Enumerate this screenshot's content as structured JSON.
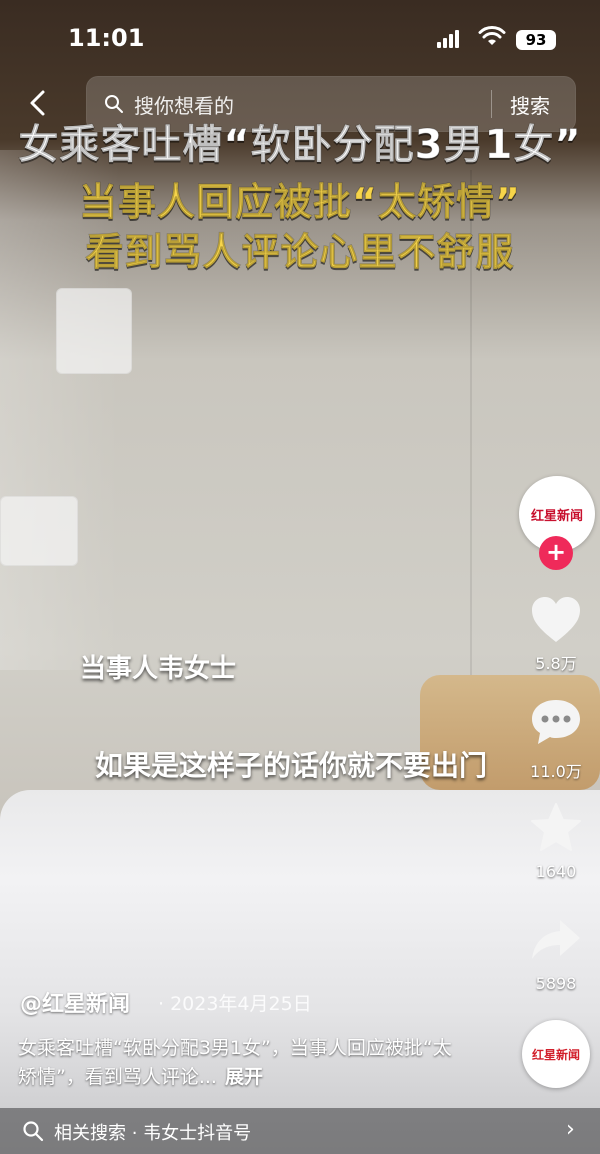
{
  "status_bar": {
    "time": "11:01",
    "battery": "93"
  },
  "search": {
    "placeholder": "搜你想看的",
    "button": "搜索"
  },
  "video_overlay": {
    "headline_line1": "女乘客吐槽“软卧分配3男1女”",
    "headline_line2": "当事人回应被批“太矫情”",
    "headline_line3": "看到骂人评论心里不舒服",
    "speaker_label": "当事人韦女士",
    "subtitle": "如果是这样子的话你就不要出门"
  },
  "right_rail": {
    "avatar_label": "红星新闻",
    "likes": "5.8万",
    "comments": "11.0万",
    "favorites": "1640",
    "shares": "5898",
    "music_label": "红星新闻"
  },
  "post": {
    "author": "@红星新闻",
    "date": "· 2023年4月25日",
    "description": "女乘客吐槽“软卧分配3男1女”，当事人回应被批“太矫情”，看到骂人评论...",
    "expand": "展开"
  },
  "related": {
    "label": "相关搜索 · 韦女士抖音号"
  },
  "colors": {
    "headline_yellow": "#f7d54a",
    "follow_pink": "#ef2a5a"
  }
}
